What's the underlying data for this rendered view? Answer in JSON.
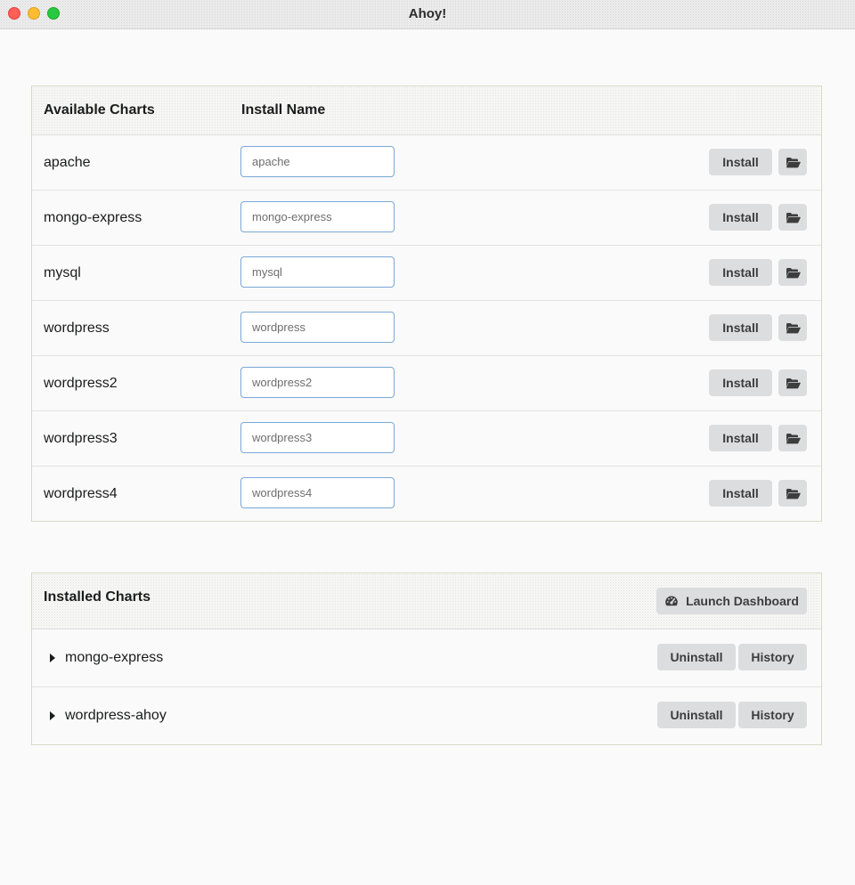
{
  "window": {
    "title": "Ahoy!"
  },
  "available": {
    "header_chart": "Available Charts",
    "header_install_name": "Install Name",
    "install_label": "Install",
    "rows": [
      {
        "name": "apache",
        "placeholder": "apache"
      },
      {
        "name": "mongo-express",
        "placeholder": "mongo-express"
      },
      {
        "name": "mysql",
        "placeholder": "mysql"
      },
      {
        "name": "wordpress",
        "placeholder": "wordpress"
      },
      {
        "name": "wordpress2",
        "placeholder": "wordpress2"
      },
      {
        "name": "wordpress3",
        "placeholder": "wordpress3"
      },
      {
        "name": "wordpress4",
        "placeholder": "wordpress4"
      }
    ]
  },
  "installed": {
    "header": "Installed Charts",
    "dashboard_label": "Launch Dashboard",
    "uninstall_label": "Uninstall",
    "history_label": "History",
    "rows": [
      {
        "name": "mongo-express"
      },
      {
        "name": "wordpress-ahoy"
      }
    ]
  },
  "icons": {
    "folder": "folder-open-icon",
    "dashboard": "dashboard-gauge-icon",
    "expand": "caret-right-icon"
  },
  "colors": {
    "button_bg": "#dcdddf",
    "input_border": "#7aa7d8",
    "close": "#fe5f57",
    "minimize": "#febc2e",
    "maximize": "#28c840"
  }
}
